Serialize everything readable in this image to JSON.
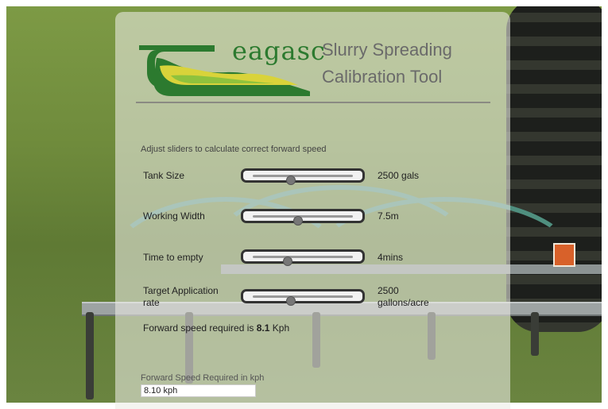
{
  "header": {
    "logo_text": "eagasc",
    "title_line1": "Slurry Spreading",
    "title_line2": "Calibration Tool"
  },
  "instructions": "Adjust sliders to calculate correct forward speed",
  "sliders": [
    {
      "label": "Tank Size",
      "value_text": "2500 gals",
      "position": 0.38
    },
    {
      "label": "Working Width",
      "value_text": "7.5m",
      "position": 0.45
    },
    {
      "label": "Time to empty",
      "value_text": "4mins",
      "position": 0.35
    },
    {
      "label": "Target Application rate",
      "value_text": "2500 gallons/acre",
      "position": 0.38
    }
  ],
  "result": {
    "prefix": "Forward speed required is",
    "value": "8.1",
    "unit": "Kph"
  },
  "speed_field": {
    "label": "Forward Speed Required in kph",
    "value": "8.10 kph"
  },
  "colors": {
    "logo_green": "#2c7a2f",
    "logo_yellow": "#d9d33a",
    "logo_light_green": "#8fc23d",
    "panel_overlay": "rgba(236,236,230,0.58)"
  }
}
